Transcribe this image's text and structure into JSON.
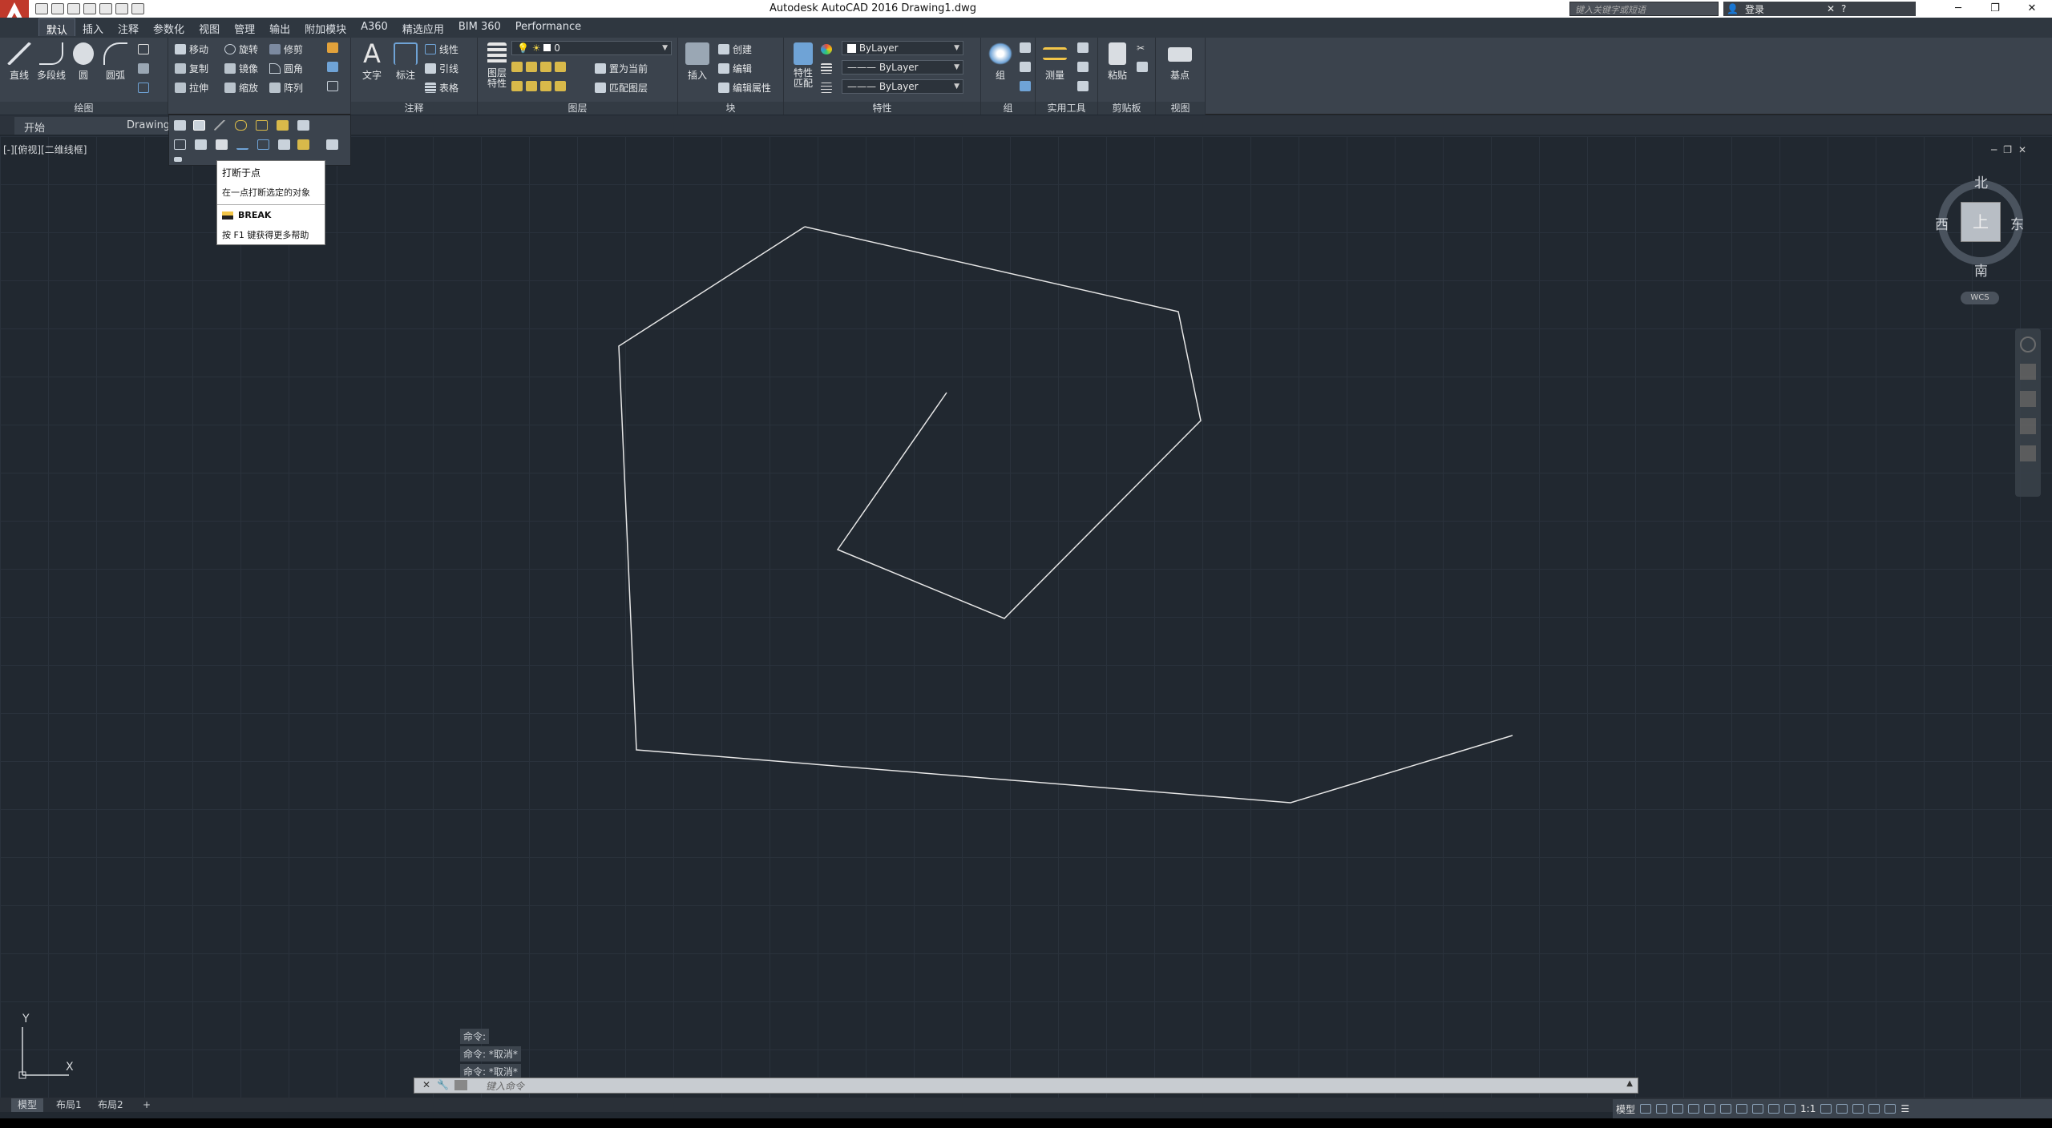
{
  "app": {
    "title": "Autodesk AutoCAD 2016    Drawing1.dwg",
    "search_placeholder": "键入关键字或短语",
    "login_label": "登录"
  },
  "ribbon_tabs": [
    "默认",
    "插入",
    "注释",
    "参数化",
    "视图",
    "管理",
    "输出",
    "附加模块",
    "A360",
    "精选应用",
    "BIM 360",
    "Performance"
  ],
  "draw_panel": {
    "title": "绘图",
    "line": "直线",
    "polyline": "多段线",
    "circle": "圆",
    "arc": "圆弧"
  },
  "modify_panel": {
    "move": "移动",
    "rotate": "旋转",
    "trim": "修剪",
    "copy": "复制",
    "mirror": "镜像",
    "fillet": "圆角",
    "stretch": "拉伸",
    "scale": "缩放",
    "array": "阵列"
  },
  "annotation_panel": {
    "title": "注释",
    "text": "文字",
    "dimension": "标注",
    "linear": "线性",
    "leader": "引线",
    "table": "表格"
  },
  "layers_panel": {
    "title": "图层",
    "layer_props": "图层\n特性",
    "layer_value": "0",
    "make_current": "置为当前",
    "match_layer": "匹配图层"
  },
  "block_panel": {
    "title": "块",
    "insert": "插入",
    "create": "创建",
    "edit": "编辑",
    "edit_attr": "编辑属性"
  },
  "properties_panel": {
    "title": "特性",
    "match": "特性\n匹配",
    "color": "ByLayer",
    "linetype": "ByLayer",
    "lineweight": "ByLayer"
  },
  "groups_panel": {
    "title": "组",
    "group": "组"
  },
  "utilities_panel": {
    "title": "实用工具",
    "measure": "测量"
  },
  "clipboard_panel": {
    "title": "剪贴板",
    "paste": "粘贴"
  },
  "view_panel": {
    "title": "视图",
    "base": "基点"
  },
  "file_tabs": {
    "start": "开始",
    "drawing": "Drawing1"
  },
  "viewport_label": "[-][俯视][二维线框]",
  "tooltip": {
    "title": "打断于点",
    "desc": "在一点打断选定的对象",
    "command": "BREAK",
    "help": "按 F1 键获得更多帮助"
  },
  "viewcube": {
    "north": "北",
    "south": "南",
    "east": "东",
    "west": "西",
    "face": "上",
    "wcs": "WCS"
  },
  "ucs": {
    "x": "X",
    "y": "Y"
  },
  "command_history": [
    "命令:",
    "命令: *取消*",
    "命令: *取消*"
  ],
  "command_placeholder": "键入命令",
  "layout_tabs": [
    "模型",
    "布局1",
    "布局2"
  ],
  "status": {
    "model": "模型",
    "scale": "1:1"
  },
  "colors": {
    "canvas": "#212830",
    "ribbon": "#3b434d",
    "app_button": "#c0392b"
  }
}
